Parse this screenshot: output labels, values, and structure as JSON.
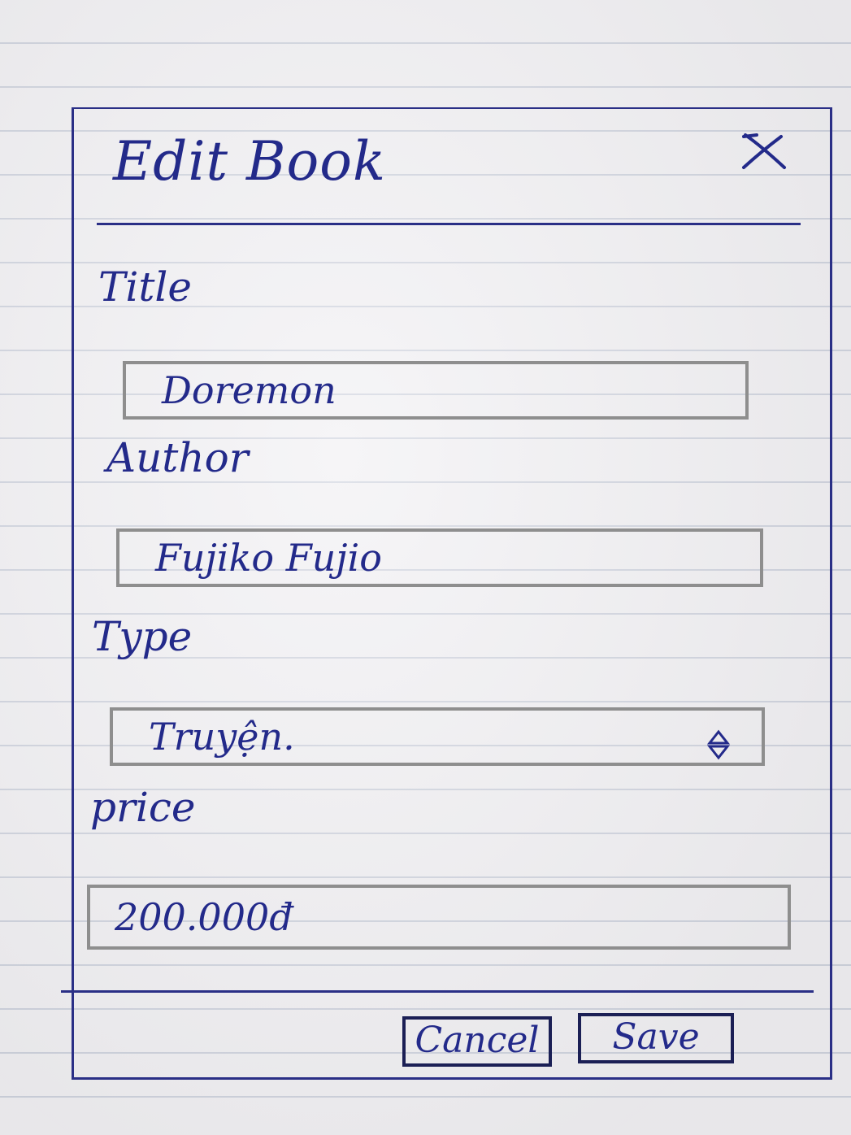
{
  "dialog": {
    "title": "Edit Book",
    "close_icon": "close-icon"
  },
  "fields": {
    "title": {
      "label": "Title",
      "value": "Doremon"
    },
    "author": {
      "label": "Author",
      "value": "Fujiko Fujio"
    },
    "type": {
      "label": "Type",
      "value": "Truyện.",
      "icon": "select-arrows-icon"
    },
    "price": {
      "label": "price",
      "value": "200.000đ"
    }
  },
  "buttons": {
    "cancel": "Cancel",
    "save": "Save"
  },
  "colors": {
    "ink": "#232a8a",
    "pencil": "#8e8e8e",
    "paper": "#f1f0f3"
  }
}
